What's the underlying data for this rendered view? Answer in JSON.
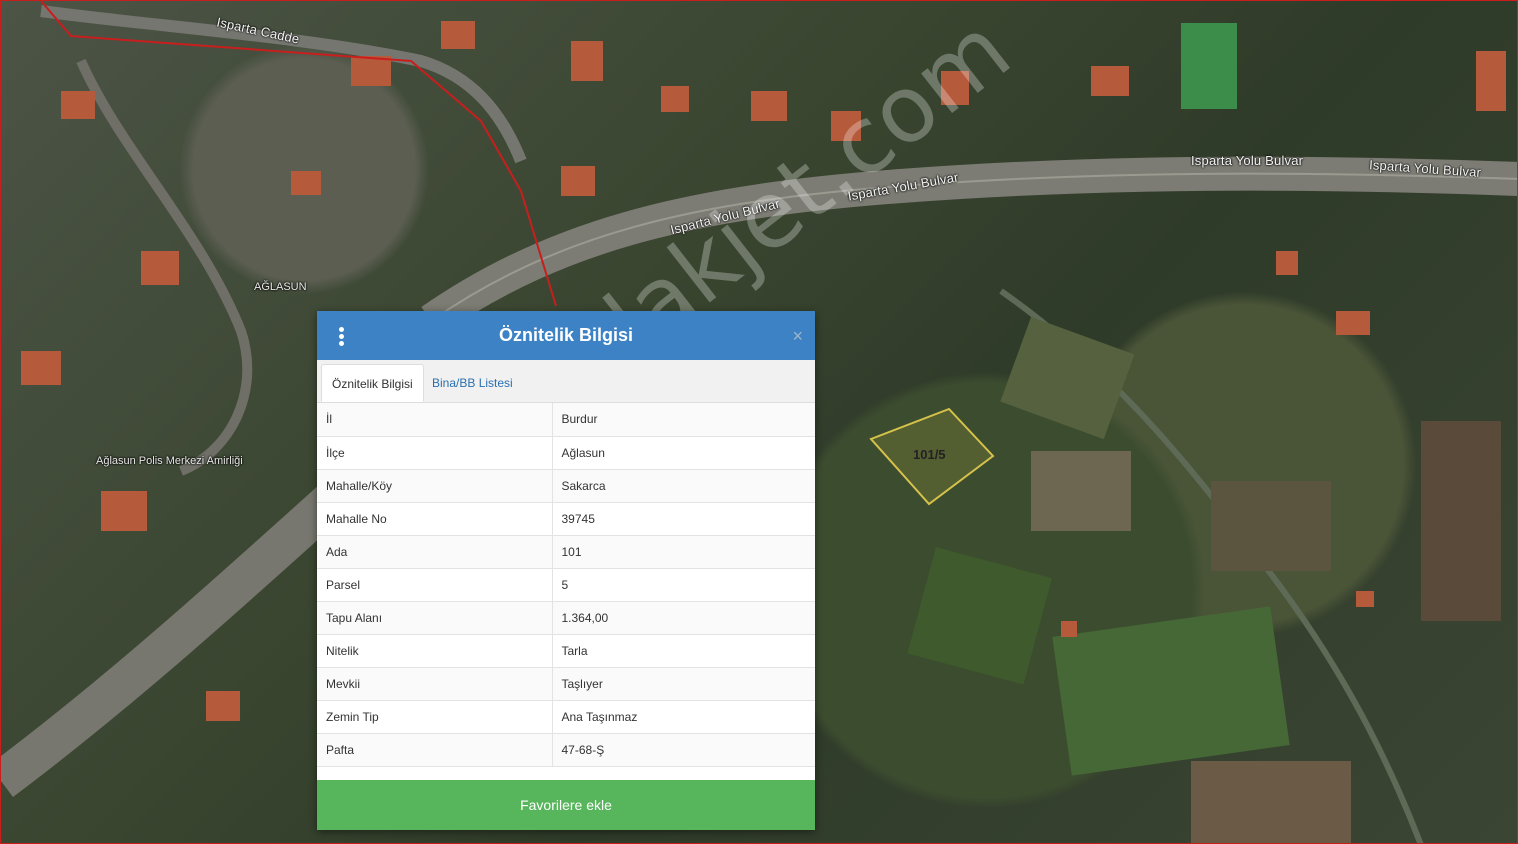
{
  "map": {
    "road_labels": {
      "isparta_cadde": "Isparta Cadde",
      "bulvar_1": "Isparta Yolu Bulvar",
      "bulvar_2": "Isparta Yolu Bulvar",
      "bulvar_3": "Isparta Yolu Bulvar",
      "bulvar_4": "Isparta Yolu Bulvar"
    },
    "place_labels": {
      "town": "AĞLASUN",
      "police": "Ağlasun Polis Merkezi Amirliği"
    },
    "parcel_label": "101/5",
    "watermark": "emlakjet.com",
    "colors": {
      "boundary": "#c81e1e",
      "parcel_outline": "#d6c24a"
    }
  },
  "popup": {
    "title": "Öznitelik Bilgisi",
    "close_symbol": "×",
    "menu_icon": "kebab-menu-icon",
    "tabs": {
      "active": "Öznitelik Bilgisi",
      "second": "Bina/BB Listesi"
    },
    "rows": [
      {
        "key": "İl",
        "value": "Burdur"
      },
      {
        "key": "İlçe",
        "value": "Ağlasun"
      },
      {
        "key": "Mahalle/Köy",
        "value": "Sakarca"
      },
      {
        "key": "Mahalle No",
        "value": "39745"
      },
      {
        "key": "Ada",
        "value": "101"
      },
      {
        "key": "Parsel",
        "value": "5"
      },
      {
        "key": "Tapu Alanı",
        "value": "1.364,00"
      },
      {
        "key": "Nitelik",
        "value": "Tarla"
      },
      {
        "key": "Mevkii",
        "value": "Taşlıyer"
      },
      {
        "key": "Zemin Tip",
        "value": "Ana Taşınmaz"
      },
      {
        "key": "Pafta",
        "value": "47-68-Ş"
      }
    ],
    "favorite_button": "Favorilere ekle",
    "colors": {
      "header": "#3c82c4",
      "button": "#57b65b",
      "link": "#2a6fb0"
    }
  }
}
